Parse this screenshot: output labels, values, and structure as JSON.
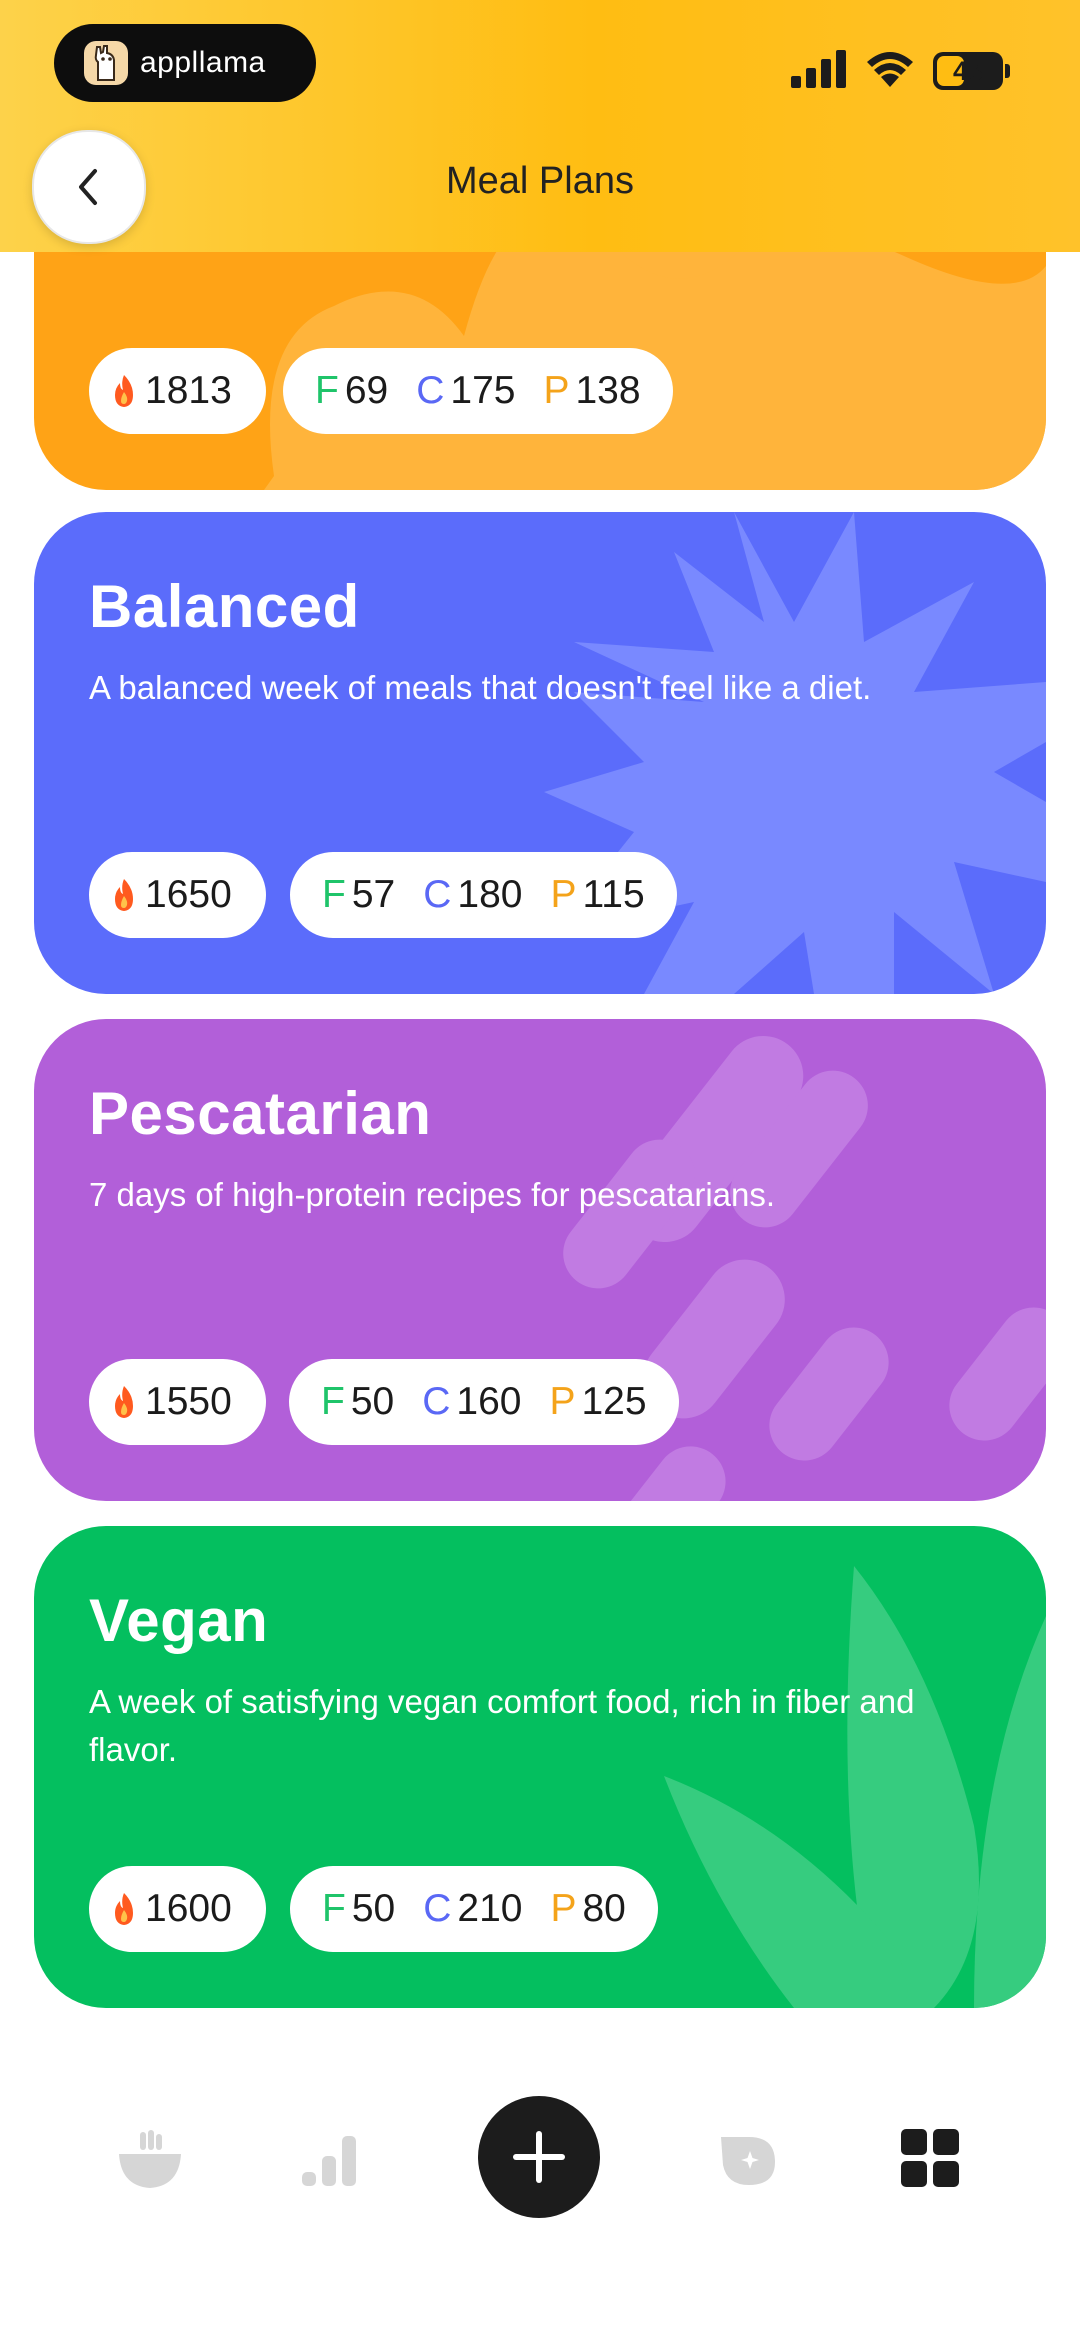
{
  "header": {
    "brand": "appllama",
    "battery": "43",
    "battery_percent": 43,
    "title": "Meal Plans"
  },
  "colors": {
    "header": "#ffbd12",
    "orange_card": "#ffa316",
    "balanced_card": "#5b6cfb",
    "pescatarian_card": "#b25fd9",
    "vegan_card": "#04bf5f",
    "fat": "#1fc46a",
    "carbs": "#5a68f5",
    "protein": "#f4a31a"
  },
  "plans": [
    {
      "title": "",
      "description": "",
      "calories": "1813",
      "fat_label": "F",
      "fat": "69",
      "carbs_label": "C",
      "carbs": "175",
      "protein_label": "P",
      "protein": "138"
    },
    {
      "title": "Balanced",
      "description": "A balanced week of meals that doesn't feel like a diet.",
      "calories": "1650",
      "fat_label": "F",
      "fat": "57",
      "carbs_label": "C",
      "carbs": "180",
      "protein_label": "P",
      "protein": "115"
    },
    {
      "title": "Pescatarian",
      "description": "7 days of high-protein recipes for pescatarians.",
      "calories": "1550",
      "fat_label": "F",
      "fat": "50",
      "carbs_label": "C",
      "carbs": "160",
      "protein_label": "P",
      "protein": "125"
    },
    {
      "title": "Vegan",
      "description": "A week of satisfying vegan comfort food, rich in fiber and flavor.",
      "calories": "1600",
      "fat_label": "F",
      "fat": "50",
      "carbs_label": "C",
      "carbs": "210",
      "protein_label": "P",
      "protein": "80"
    }
  ],
  "nav": {
    "items": [
      {
        "icon": "bowl-icon"
      },
      {
        "icon": "stats-icon"
      },
      {
        "icon": "plus-icon"
      },
      {
        "icon": "badge-icon"
      },
      {
        "icon": "grid-icon"
      }
    ]
  }
}
